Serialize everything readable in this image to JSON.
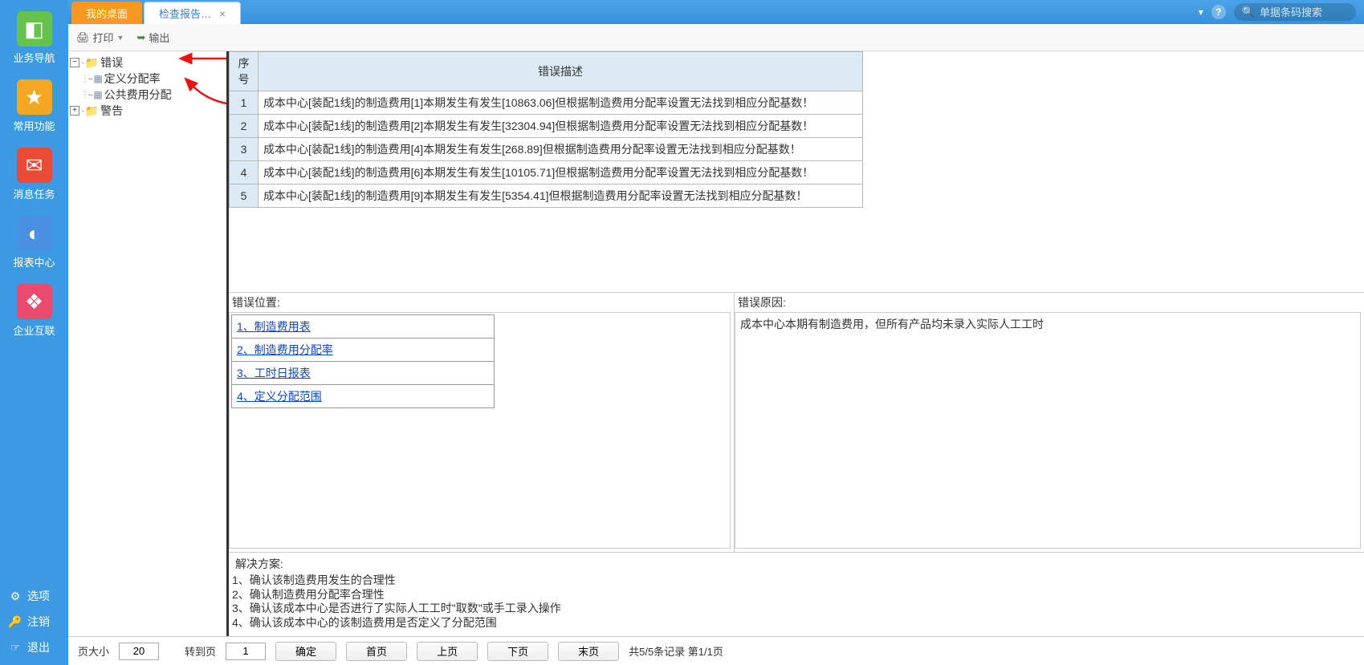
{
  "left_nav": {
    "items": [
      {
        "label": "业务导航",
        "icon": "◧",
        "color": "bg-green"
      },
      {
        "label": "常用功能",
        "icon": "★",
        "color": "bg-orange"
      },
      {
        "label": "消息任务",
        "icon": "✉",
        "color": "bg-red"
      },
      {
        "label": "报表中心",
        "icon": "◐",
        "color": "bg-blue"
      },
      {
        "label": "企业互联",
        "icon": "❖",
        "color": "bg-pink"
      }
    ],
    "bottom": [
      {
        "label": "选项",
        "icon": "⚙"
      },
      {
        "label": "注销",
        "icon": "🔑"
      },
      {
        "label": "退出",
        "icon": "☞"
      }
    ]
  },
  "tabs": {
    "desktop": "我的桌面",
    "report": "检查报告…"
  },
  "header": {
    "search_placeholder": "单据条码搜索"
  },
  "toolbar": {
    "print": "打印",
    "export": "输出"
  },
  "tree": {
    "error": "错误",
    "child1": "定义分配率",
    "child2": "公共费用分配",
    "warn": "警告"
  },
  "table": {
    "col_seq": "序号",
    "col_desc": "错误描述",
    "rows": [
      {
        "seq": "1",
        "desc": "成本中心[装配1线]的制造费用[1]本期发生有发生[10863.06]但根据制造费用分配率设置无法找到相应分配基数！"
      },
      {
        "seq": "2",
        "desc": "成本中心[装配1线]的制造费用[2]本期发生有发生[32304.94]但根据制造费用分配率设置无法找到相应分配基数！"
      },
      {
        "seq": "3",
        "desc": "成本中心[装配1线]的制造费用[4]本期发生有发生[268.89]但根据制造费用分配率设置无法找到相应分配基数！"
      },
      {
        "seq": "4",
        "desc": "成本中心[装配1线]的制造费用[6]本期发生有发生[10105.71]但根据制造费用分配率设置无法找到相应分配基数！"
      },
      {
        "seq": "5",
        "desc": "成本中心[装配1线]的制造费用[9]本期发生有发生[5354.41]但根据制造费用分配率设置无法找到相应分配基数！"
      }
    ]
  },
  "mid": {
    "loc_label": "错误位置:",
    "loc_links": [
      "1、制造费用表",
      "2、制造费用分配率",
      "3、工时日报表",
      "4、定义分配范围"
    ],
    "reason_label": "错误原因:",
    "reason_text": "成本中心本期有制造费用，但所有产品均未录入实际人工工时"
  },
  "solution": {
    "label": "解决方案:",
    "lines": [
      "1、确认该制造费用发生的合理性",
      "2、确认制造费用分配率合理性",
      "3、确认该成本中心是否进行了实际人工工时\"取数\"或手工录入操作",
      "4、确认该成本中心的该制造费用是否定义了分配范围"
    ]
  },
  "pager": {
    "page_size_label": "页大小",
    "page_size_value": "20",
    "goto_label": "转到页",
    "goto_value": "1",
    "confirm": "确定",
    "first": "首页",
    "prev": "上页",
    "next": "下页",
    "last": "末页",
    "info": "共5/5条记录 第1/1页"
  }
}
